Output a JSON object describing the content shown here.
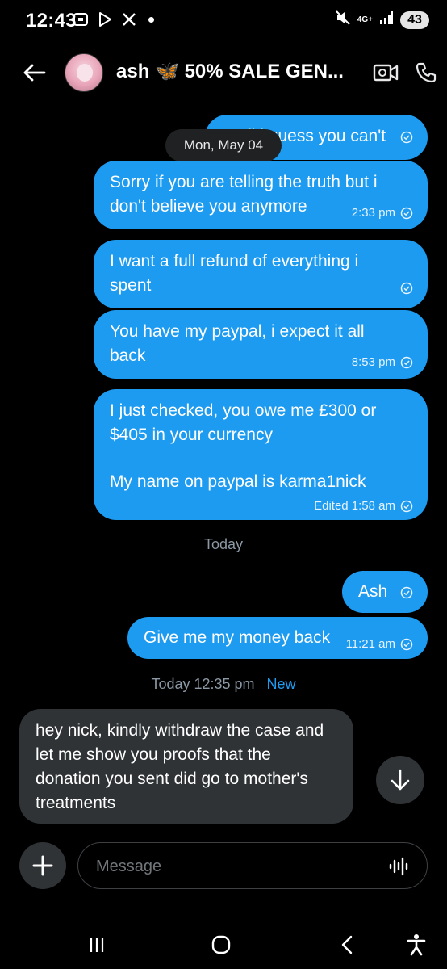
{
  "status_bar": {
    "time": "12:43",
    "network": "4G+",
    "battery": "43",
    "icons": [
      "screenshot-icon",
      "play-store-icon",
      "x-logo-icon",
      "mute-icon",
      "signal-icon"
    ]
  },
  "header": {
    "title": "ash 🦋 50% SALE GEN...",
    "icons": [
      "back-arrow-icon",
      "video-call-icon",
      "phone-call-icon"
    ]
  },
  "date_separator": "Mon, May 04",
  "messages": [
    {
      "text": "Well i guess you can't",
      "time": ""
    },
    {
      "text": "Sorry if you are telling the truth but i don't believe you anymore",
      "time": "2:33 pm"
    },
    {
      "text": "I want a full refund of everything i spent",
      "time": ""
    },
    {
      "text": "You have my paypal, i expect it all back",
      "time": "8:53 pm"
    },
    {
      "line1": "I just checked, you owe me £300 or $405 in your currency",
      "line2": "My name on paypal is karma1nick",
      "time": "Edited 1:58 am"
    },
    {
      "text": "Ash",
      "time": ""
    },
    {
      "text": "Give me my money back",
      "time": "11:21 am"
    }
  ],
  "today_label": "Today",
  "new_separator": {
    "time": "Today 12:35 pm",
    "new_label": "New"
  },
  "incoming": {
    "text": "hey nick, kindly withdraw the case and let me show you proofs that the donation you sent did go to mother's treatments"
  },
  "composer": {
    "placeholder": "Message"
  },
  "colors": {
    "accent": "#1d9bf0",
    "incoming_bubble": "#2f3336",
    "background": "#000000"
  }
}
